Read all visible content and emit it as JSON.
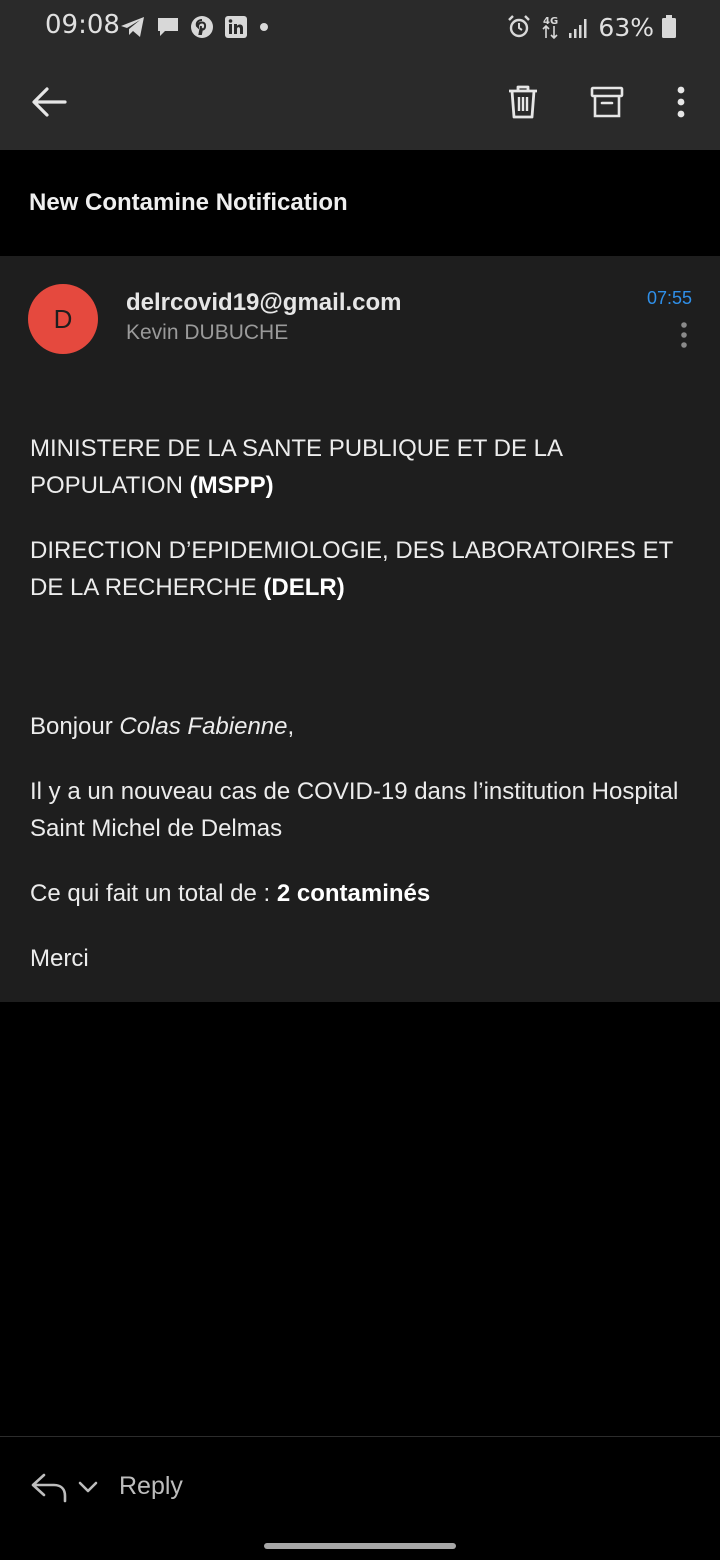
{
  "status_bar": {
    "time": "09:08",
    "left_icons": [
      "telegram-icon",
      "chat-icon",
      "pinterest-icon",
      "linkedin-icon",
      "dot-icon"
    ],
    "right_icons": [
      "alarm-icon",
      "data-4g-icon",
      "signal-icon",
      "battery-icon"
    ],
    "battery_percent": "63%"
  },
  "toolbar": {
    "back_icon": "arrow-left-icon",
    "delete_icon": "trash-icon",
    "archive_icon": "archive-icon",
    "more_icon": "more-vertical-icon"
  },
  "subject": "New Contamine Notification",
  "message": {
    "avatar_letter": "D",
    "avatar_color": "#e5493e",
    "sender_email": "delrcovid19@gmail.com",
    "sender_name": "Kevin DUBUCHE",
    "time": "07:55",
    "time_color": "#2f8fe8",
    "body": {
      "p1_text": "MINISTERE DE LA SANTE PUBLIQUE ET DE LA POPULATION ",
      "p1_bold": "(MSPP)",
      "p2_text": "DIRECTION D’EPIDEMIOLOGIE, DES LABORATOIRES ET DE LA RECHERCHE ",
      "p2_bold": "(DELR)",
      "greeting_prefix": "Bonjour ",
      "greeting_name": "Colas Fabienne",
      "greeting_suffix": ",",
      "p4_text": "Il y a un nouveau cas de COVID-19 dans l’institution Hospital Saint Michel de Delmas",
      "p5_text": "Ce qui fait un total de : ",
      "p5_bold": "2 contaminés",
      "closing": "Merci"
    }
  },
  "reply_bar": {
    "reply_icon": "reply-icon",
    "chevron_icon": "chevron-down-icon",
    "label": "Reply"
  }
}
